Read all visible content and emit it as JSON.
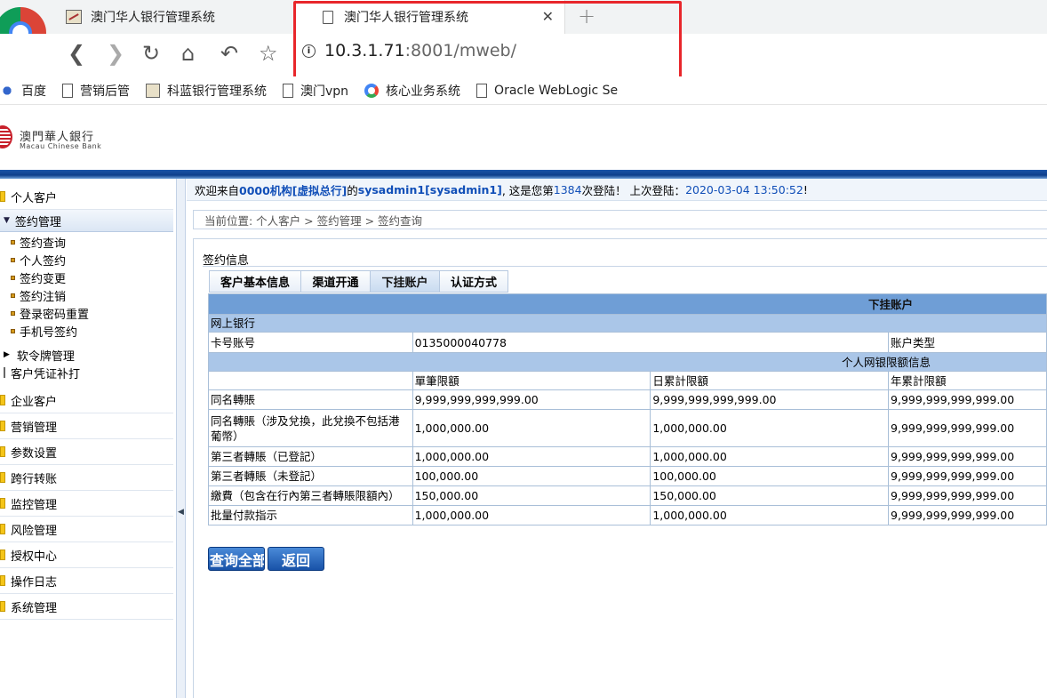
{
  "browser": {
    "tabs": [
      {
        "title": "澳门华人银行管理系统"
      },
      {
        "title": "澳门华人银行管理系统"
      }
    ],
    "url_host": "10.3.1.71",
    "url_rest": ":8001/mweb/",
    "bookmarks": [
      "百度",
      "营销后管",
      "科蓝银行管理系统",
      "澳门vpn",
      "核心业务系统",
      "Oracle WebLogic Se"
    ]
  },
  "brand": {
    "name_cn": "澳門華人銀行",
    "name_en": "Macau Chinese Bank"
  },
  "welcome": {
    "p1": "欢迎来自",
    "org": "0000机构[虚拟总行]",
    "p2": "的",
    "user": "sysadmin1[sysadmin1]",
    "p3": ", 这是您第 ",
    "count": "1384",
    "p4": "次登陆！ 上次登陆：",
    "last_login": "2020-03-04 13:50:52",
    "p5": "!"
  },
  "breadcrumb": "当前位置: 个人客户 > 签约管理 > 签约查询",
  "sidebar": {
    "personal": "个人客户",
    "sign_mgmt": "签约管理",
    "sign_items": [
      "签约查询",
      "个人签约",
      "签约变更",
      "签约注销",
      "登录密码重置",
      "手机号签约"
    ],
    "soft_token": "软令牌管理",
    "cert": "客户凭证补打",
    "groups": [
      "企业客户",
      "营销管理",
      "参数设置",
      "跨行转账",
      "监控管理",
      "风险管理",
      "授权中心",
      "操作日志",
      "系统管理"
    ]
  },
  "panel": {
    "title": "签约信息",
    "tabs": [
      "客户基本信息",
      "渠道开通",
      "下挂账户",
      "认证方式"
    ],
    "active_tab": "下挂账户"
  },
  "table": {
    "header": "下挂账户",
    "section1": "网上银行",
    "card_label": "卡号账号",
    "card_value": "0135000040778",
    "acct_type_label": "账户类型",
    "limits_title": "个人网银限额信息",
    "columns": [
      "單筆限額",
      "日累計限額",
      "年累計限額"
    ],
    "rows": [
      {
        "name": "同名轉賬",
        "single": "9,999,999,999,999.00",
        "daily": "9,999,999,999,999.00",
        "yearly": "9,999,999,999,999.00"
      },
      {
        "name": "同名轉賬（涉及兌換，此兌換不包括港葡幣）",
        "single": "1,000,000.00",
        "daily": "1,000,000.00",
        "yearly": "9,999,999,999,999.00"
      },
      {
        "name": "第三者轉賬（已登記）",
        "single": "1,000,000.00",
        "daily": "1,000,000.00",
        "yearly": "9,999,999,999,999.00"
      },
      {
        "name": "第三者轉賬（未登記）",
        "single": "100,000.00",
        "daily": "100,000.00",
        "yearly": "9,999,999,999,999.00"
      },
      {
        "name": "繳費（包含在行內第三者轉賬限額內）",
        "single": "150,000.00",
        "daily": "150,000.00",
        "yearly": "9,999,999,999,999.00"
      },
      {
        "name": "批量付款指示",
        "single": "1,000,000.00",
        "daily": "1,000,000.00",
        "yearly": "9,999,999,999,999.00"
      }
    ]
  },
  "buttons": {
    "query_all": "查询全部",
    "back": "返回"
  }
}
